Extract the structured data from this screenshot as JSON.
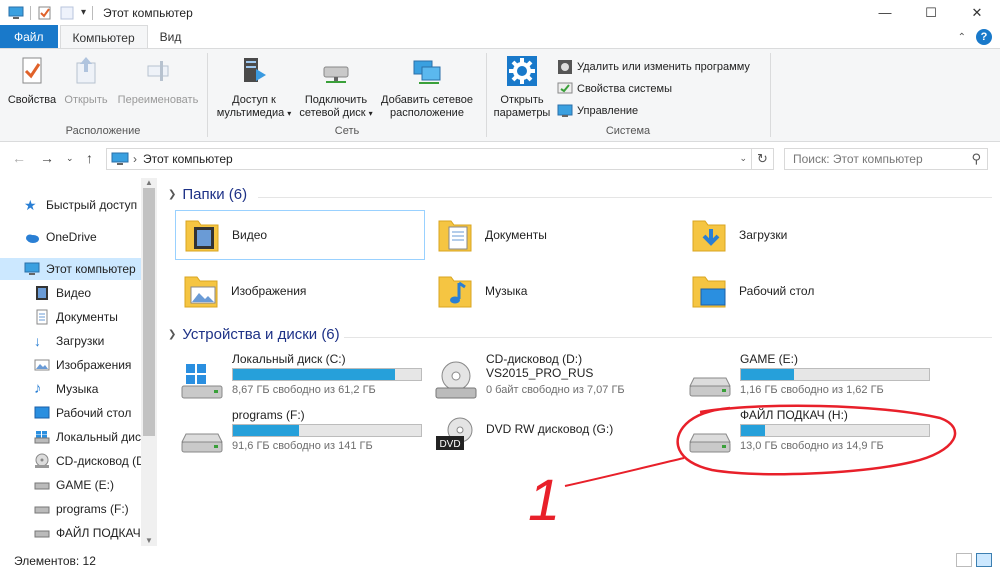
{
  "window": {
    "title": "Этот компьютер",
    "minimize": "—",
    "maximize": "☐",
    "close": "✕"
  },
  "tabs": {
    "file": "Файл",
    "computer": "Компьютер",
    "view": "Вид",
    "help": "?"
  },
  "ribbon": {
    "location_group": "Расположение",
    "network_group": "Сеть",
    "system_group": "Система",
    "properties": "Свойства",
    "open": "Открыть",
    "rename": "Переименовать",
    "media_access_1": "Доступ к",
    "media_access_2": "мультимедиа",
    "map_drive_1": "Подключить",
    "map_drive_2": "сетевой диск",
    "add_location_1": "Добавить сетевое",
    "add_location_2": "расположение",
    "open_settings_1": "Открыть",
    "open_settings_2": "параметры",
    "uninstall": "Удалить или изменить программу",
    "system_props": "Свойства системы",
    "manage": "Управление"
  },
  "address": {
    "path": "Этот компьютер",
    "separator": "›",
    "search_placeholder": "Поиск: Этот компьютер"
  },
  "nav": {
    "items": [
      {
        "label": "Быстрый доступ"
      },
      {
        "label": "OneDrive"
      },
      {
        "label": "Этот компьютер"
      },
      {
        "label": "Видео"
      },
      {
        "label": "Документы"
      },
      {
        "label": "Загрузки"
      },
      {
        "label": "Изображения"
      },
      {
        "label": "Музыка"
      },
      {
        "label": "Рабочий стол"
      },
      {
        "label": "Локальный дис"
      },
      {
        "label": "CD-дисковод (D"
      },
      {
        "label": "GAME (E:)"
      },
      {
        "label": "programs (F:)"
      },
      {
        "label": "ФАЙЛ ПОДКАЧ"
      }
    ]
  },
  "folders": {
    "header": "Папки (6)",
    "items": [
      {
        "label": "Видео"
      },
      {
        "label": "Документы"
      },
      {
        "label": "Загрузки"
      },
      {
        "label": "Изображения"
      },
      {
        "label": "Музыка"
      },
      {
        "label": "Рабочий стол"
      }
    ]
  },
  "drives": {
    "header": "Устройства и диски (6)",
    "items": [
      {
        "name": "Локальный диск (C:)",
        "free": "8,67 ГБ свободно из 61,2 ГБ",
        "used_fraction": 0.86
      },
      {
        "name": "CD-дисковод (D:)",
        "name2": "VS2015_PRO_RUS",
        "free": "0 байт свободно из 7,07 ГБ"
      },
      {
        "name": "GAME (E:)",
        "free": "1,16 ГБ свободно из 1,62 ГБ",
        "used_fraction": 0.28
      },
      {
        "name": "programs (F:)",
        "free": "91,6 ГБ свободно из 141 ГБ",
        "used_fraction": 0.35
      },
      {
        "name": "DVD RW дисковод (G:)",
        "badge": "DVD"
      },
      {
        "name": "ФАЙЛ ПОДКАЧ (H:)",
        "free": "13,0 ГБ свободно из 14,9 ГБ",
        "used_fraction": 0.13
      }
    ]
  },
  "status": {
    "items": "Элементов: 12"
  },
  "annotation": {
    "number": "1"
  },
  "colors": {
    "accent": "#1979ca",
    "bar_fill": "#26a0da",
    "selection": "#cce8ff",
    "annotation_red": "#e8202a",
    "section_header": "#1e3287"
  }
}
